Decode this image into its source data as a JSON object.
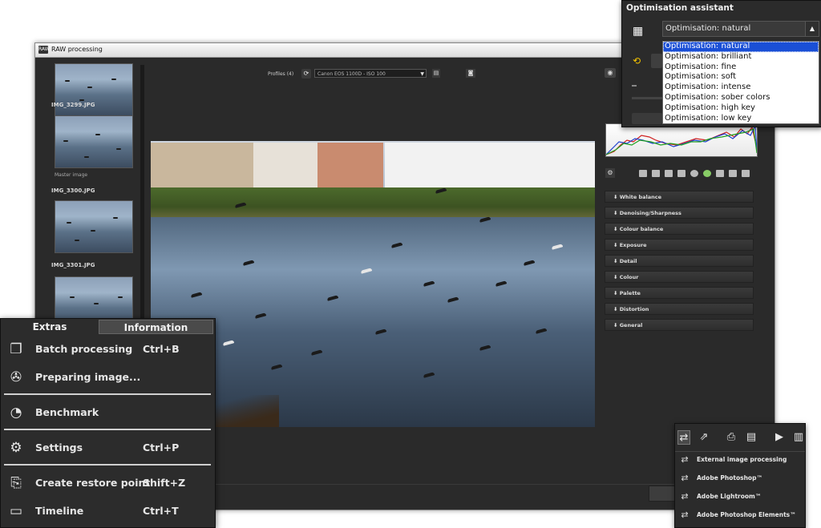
{
  "window": {
    "title": "RAW processing",
    "app_icon": "RAW"
  },
  "thumbnails": [
    {
      "label": ""
    },
    {
      "label": "IMG_3299.JPG",
      "sub": "Master image"
    },
    {
      "label": "IMG_3300.JPG"
    },
    {
      "label": "IMG_3301.JPG"
    }
  ],
  "toolbar": {
    "profiles_label": "Profiles (4)",
    "profile_value": "Canon EOS 1100D - ISO 100"
  },
  "sections": [
    "White balance",
    "Denoising/Sharpness",
    "Colour balance",
    "Exposure",
    "Detail",
    "Colour",
    "Palette",
    "Distortion",
    "General"
  ],
  "optimisation": {
    "title": "Optimisation assistant",
    "current": "Optimisation: natural",
    "options": [
      "Optimisation: natural",
      "Optimisation: brilliant",
      "Optimisation: fine",
      "Optimisation: soft",
      "Optimisation: intense",
      "Optimisation: sober colors",
      "Optimisation: high key",
      "Optimisation: low key"
    ],
    "selected_index": 0
  },
  "extras_menu": {
    "tabs": [
      "Extras",
      "Information"
    ],
    "items": [
      {
        "label": "Batch processing",
        "shortcut": "Ctrl+B",
        "icon": "batch-icon"
      },
      {
        "label": "Preparing image...",
        "shortcut": "",
        "icon": "film-reel-icon"
      },
      {
        "label": "Benchmark",
        "shortcut": "",
        "icon": "gauge-icon"
      },
      {
        "label": "Settings",
        "shortcut": "Ctrl+P",
        "icon": "gears-icon"
      },
      {
        "label": "Create restore point",
        "shortcut": "Shift+Z",
        "icon": "restore-icon"
      },
      {
        "label": "Timeline",
        "shortcut": "Ctrl+T",
        "icon": "timeline-icon"
      }
    ]
  },
  "export_menu": {
    "items": [
      "External image processing",
      "Adobe Photoshop™",
      "Adobe Lightroom™",
      "Adobe Photoshop Elements™"
    ]
  },
  "colors": {
    "accent_blue": "#1a4fd6",
    "refresh_yellow": "#f5c400",
    "panel_dark": "#2b2b2b"
  }
}
